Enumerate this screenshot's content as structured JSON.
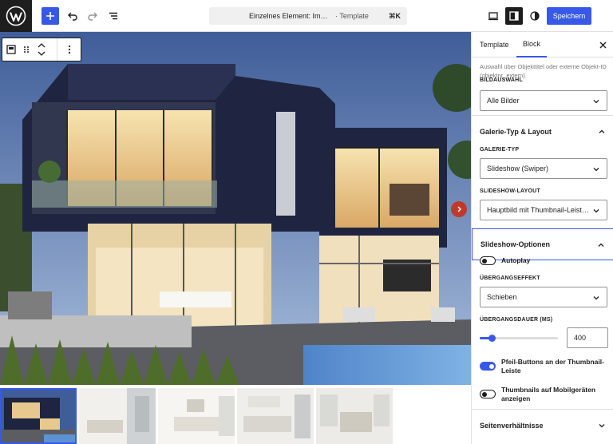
{
  "topbar": {
    "document_title": "Einzelnes Element: Immo…",
    "document_type": "· Template",
    "shortcut": "⌘K",
    "save_label": "Speichern"
  },
  "sidebar": {
    "tabs": [
      {
        "label": "Template",
        "active": false
      },
      {
        "label": "Block",
        "active": true
      }
    ],
    "help_text": "Auswahl über Objekttitel oder externe Objekt-ID (objektnr_extern).",
    "bildauswahl": {
      "label": "Bildauswahl",
      "value": "Alle Bilder"
    },
    "galerie_panel": {
      "title": "Galerie-Typ & Layout",
      "galerie_typ": {
        "label": "Galerie-Typ",
        "value": "Slideshow (Swiper)"
      },
      "slideshow_layout": {
        "label": "Slideshow-Layout",
        "value": "Hauptbild mit Thumbnail-Leiste …"
      }
    },
    "slideshow_panel": {
      "title": "Slideshow-Optionen",
      "autoplay": {
        "label": "Autoplay",
        "on": false
      },
      "effekt": {
        "label": "Übergangseffekt",
        "value": "Schieben"
      },
      "dauer": {
        "label": "Übergangsdauer (ms)",
        "value": "400",
        "fraction": 0.15
      },
      "pfeil": {
        "label": "Pfeil-Buttons an der Thumbnail-Leiste",
        "on": true
      },
      "mobil": {
        "label": "Thumbnails auf Mobilgeräten anzeigen",
        "on": false
      }
    },
    "seiten_panel": {
      "title": "Seitenverhältnisse"
    }
  },
  "canvas": {
    "thumbnail_count": 5,
    "active_thumbnail": 0
  },
  "colors": {
    "accent": "#3858e9",
    "arrow": "#c0392b"
  }
}
